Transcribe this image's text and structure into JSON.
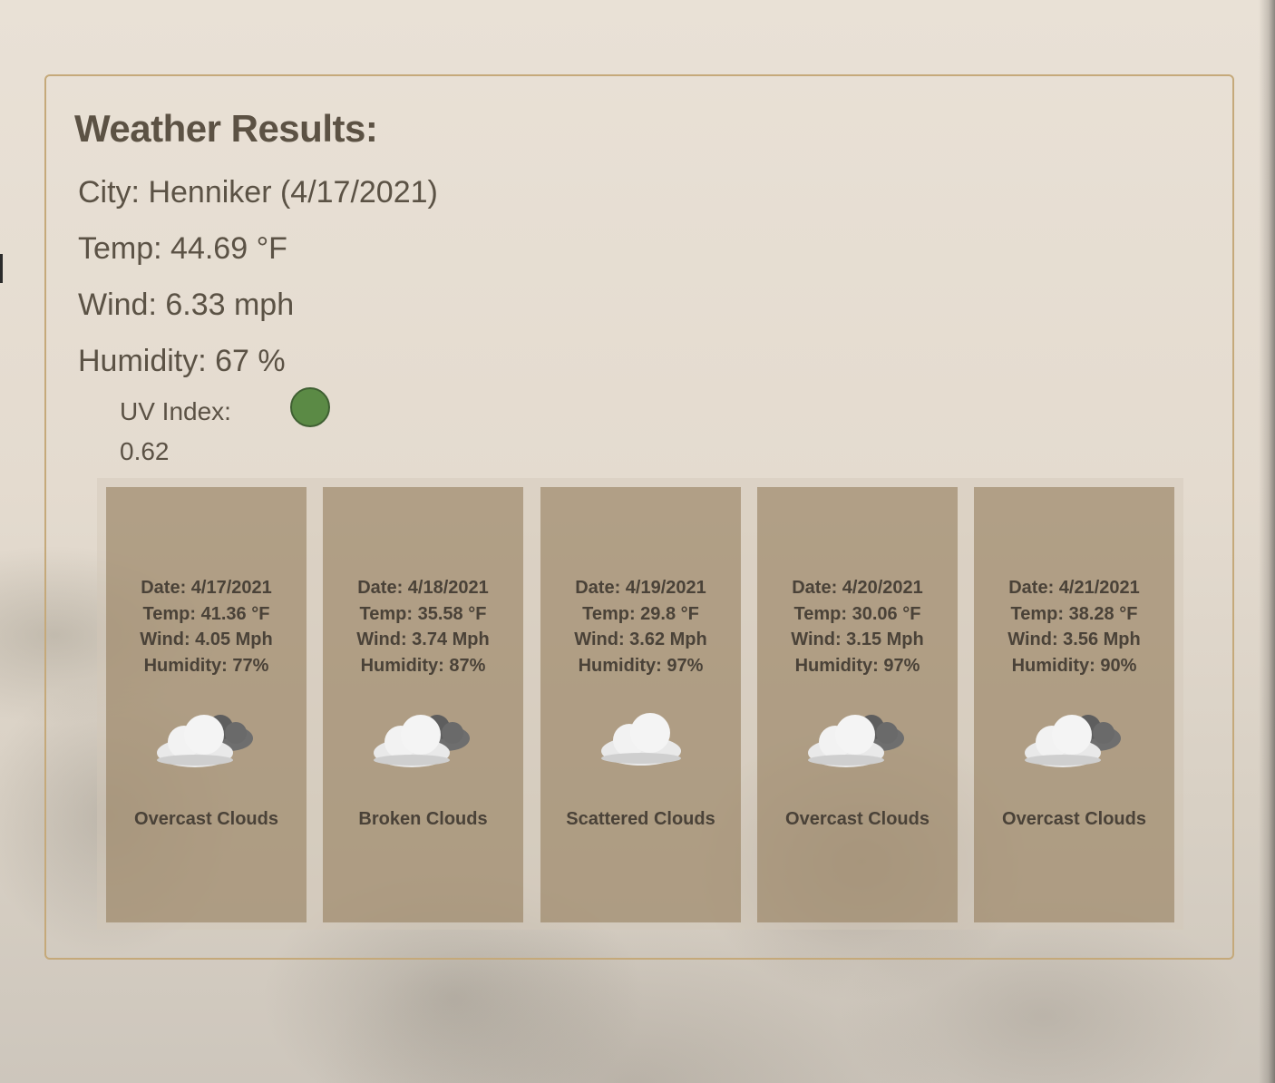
{
  "results": {
    "title": "Weather Results:",
    "city": "City: Henniker (4/17/2021)",
    "temp": "Temp: 44.69 °F",
    "wind": "Wind: 6.33 mph",
    "humidity": "Humidity: 67 %",
    "uv_label": "UV Index:",
    "uv_value": "0.62",
    "uv_color": "#5b8a45"
  },
  "forecast": [
    {
      "date": "Date: 4/17/2021",
      "temp": "Temp: 41.36 °F",
      "wind": "Wind: 4.05 Mph",
      "humidity": "Humidity: 77%",
      "icon": "overcast-clouds-icon",
      "desc": "Overcast Clouds"
    },
    {
      "date": "Date: 4/18/2021",
      "temp": "Temp: 35.58 °F",
      "wind": "Wind: 3.74 Mph",
      "humidity": "Humidity: 87%",
      "icon": "broken-clouds-icon",
      "desc": "Broken Clouds"
    },
    {
      "date": "Date: 4/19/2021",
      "temp": "Temp: 29.8 °F",
      "wind": "Wind: 3.62 Mph",
      "humidity": "Humidity: 97%",
      "icon": "scattered-clouds-icon",
      "desc": "Scattered Clouds"
    },
    {
      "date": "Date: 4/20/2021",
      "temp": "Temp: 30.06 °F",
      "wind": "Wind: 3.15 Mph",
      "humidity": "Humidity: 97%",
      "icon": "overcast-clouds-icon",
      "desc": "Overcast Clouds"
    },
    {
      "date": "Date: 4/21/2021",
      "temp": "Temp: 38.28 °F",
      "wind": "Wind: 3.56 Mph",
      "humidity": "Humidity: 90%",
      "icon": "overcast-clouds-icon",
      "desc": "Overcast Clouds"
    }
  ]
}
